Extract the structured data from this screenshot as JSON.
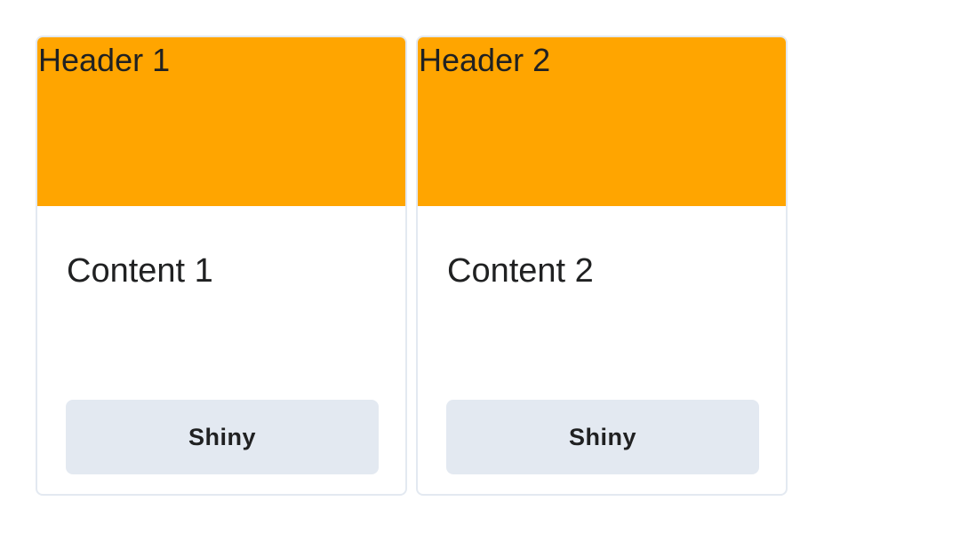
{
  "cards": [
    {
      "header": "Header 1",
      "content": "Content 1",
      "button_label": "Shiny"
    },
    {
      "header": "Header 2",
      "content": "Content 2",
      "button_label": "Shiny"
    }
  ],
  "colors": {
    "header_bg": "#ffa500",
    "button_bg": "#e3e9f1",
    "card_border": "#e3e9f1",
    "text": "#202122"
  }
}
